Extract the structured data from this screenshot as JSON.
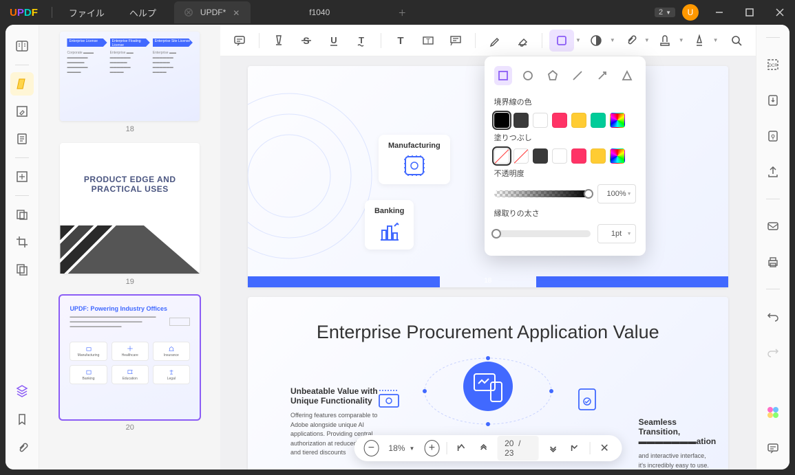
{
  "menu": {
    "file": "ファイル",
    "help": "ヘルプ"
  },
  "tabs": [
    {
      "label": "UPDF*",
      "active": true
    },
    {
      "label": "f1040",
      "active": false
    }
  ],
  "badge": "2",
  "avatar": "U",
  "thumbs": {
    "p18": "18",
    "p19": "19",
    "p20": "20",
    "t19": "PRODUCT EDGE AND PRACTICAL USES",
    "t20": "UPDF: Powering Industry Offices",
    "grid": [
      "Manufacturing",
      "Healthcare",
      "Insurance",
      "Banking",
      "Education",
      "Legal"
    ],
    "t18tabs": [
      "Enterprise License",
      "Enterprise Floating License",
      "Enterprise Site License"
    ]
  },
  "page1": {
    "card1": "Manufacturing",
    "card2": "Banking",
    "barnum": "18"
  },
  "page2": {
    "title": "Enterprise Procurement Application Value",
    "left_h": "Unbeatable Value with Unique Functionality",
    "left_p": "Offering features comparable to Adobe alongside unique AI applications. Providing central authorization at reduced rates and tiered discounts",
    "right_h": "Seamless Transition,",
    "right_h2": "ation",
    "right_p": "and interactive interface, it's incredibly easy to use. Packed with features,"
  },
  "popup": {
    "border_label": "境界線の色",
    "fill_label": "塗りつぶし",
    "opacity_label": "不透明度",
    "opacity_val": "100%",
    "stroke_label": "縁取りの太さ",
    "stroke_val": "1pt",
    "border_colors": [
      "#000000",
      "#3a3a3a",
      "#ffffff",
      "#ff3366",
      "#ffcc33",
      "#00cc99",
      "rainbow"
    ],
    "fill_colors": [
      "none",
      "none",
      "#3a3a3a",
      "#ffffff",
      "#ff3366",
      "#ffcc33",
      "rainbow"
    ]
  },
  "footer": {
    "zoom": "18%",
    "page": "20",
    "total": "23"
  }
}
